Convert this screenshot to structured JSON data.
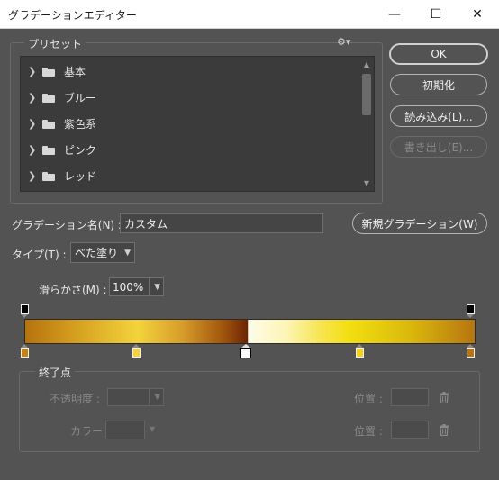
{
  "window": {
    "title": "グラデーションエディター",
    "minimize_glyph": "—",
    "maximize_glyph": "☐",
    "close_glyph": "✕"
  },
  "presets": {
    "legend": "プリセット",
    "gear_glyph": "⚙▾",
    "items": [
      {
        "label": "基本"
      },
      {
        "label": "ブルー"
      },
      {
        "label": "紫色系"
      },
      {
        "label": "ピンク"
      },
      {
        "label": "レッド"
      }
    ]
  },
  "buttons": {
    "ok": "OK",
    "reset": "初期化",
    "load": "読み込み(L)...",
    "save": "書き出し(E)..."
  },
  "name_row": {
    "label": "グラデーション名(N) :",
    "value": "カスタム",
    "new_button": "新規グラデーション(W)"
  },
  "type_row": {
    "label": "タイプ(T) :",
    "value": "べた塗り"
  },
  "smoothness": {
    "label": "滑らかさ(M) :",
    "value": "100%"
  },
  "stops_group": {
    "legend": "終了点",
    "opacity_label": "不透明度 :",
    "opacity_location_label": "位置 :",
    "color_label": "カラー :",
    "color_location_label": "位置 :"
  },
  "colors": {
    "stop1": "#c48214",
    "stop2": "#f5d23a",
    "stop3": "#ffffff",
    "stop4": "#f0d21a",
    "stop5": "#b77510"
  }
}
